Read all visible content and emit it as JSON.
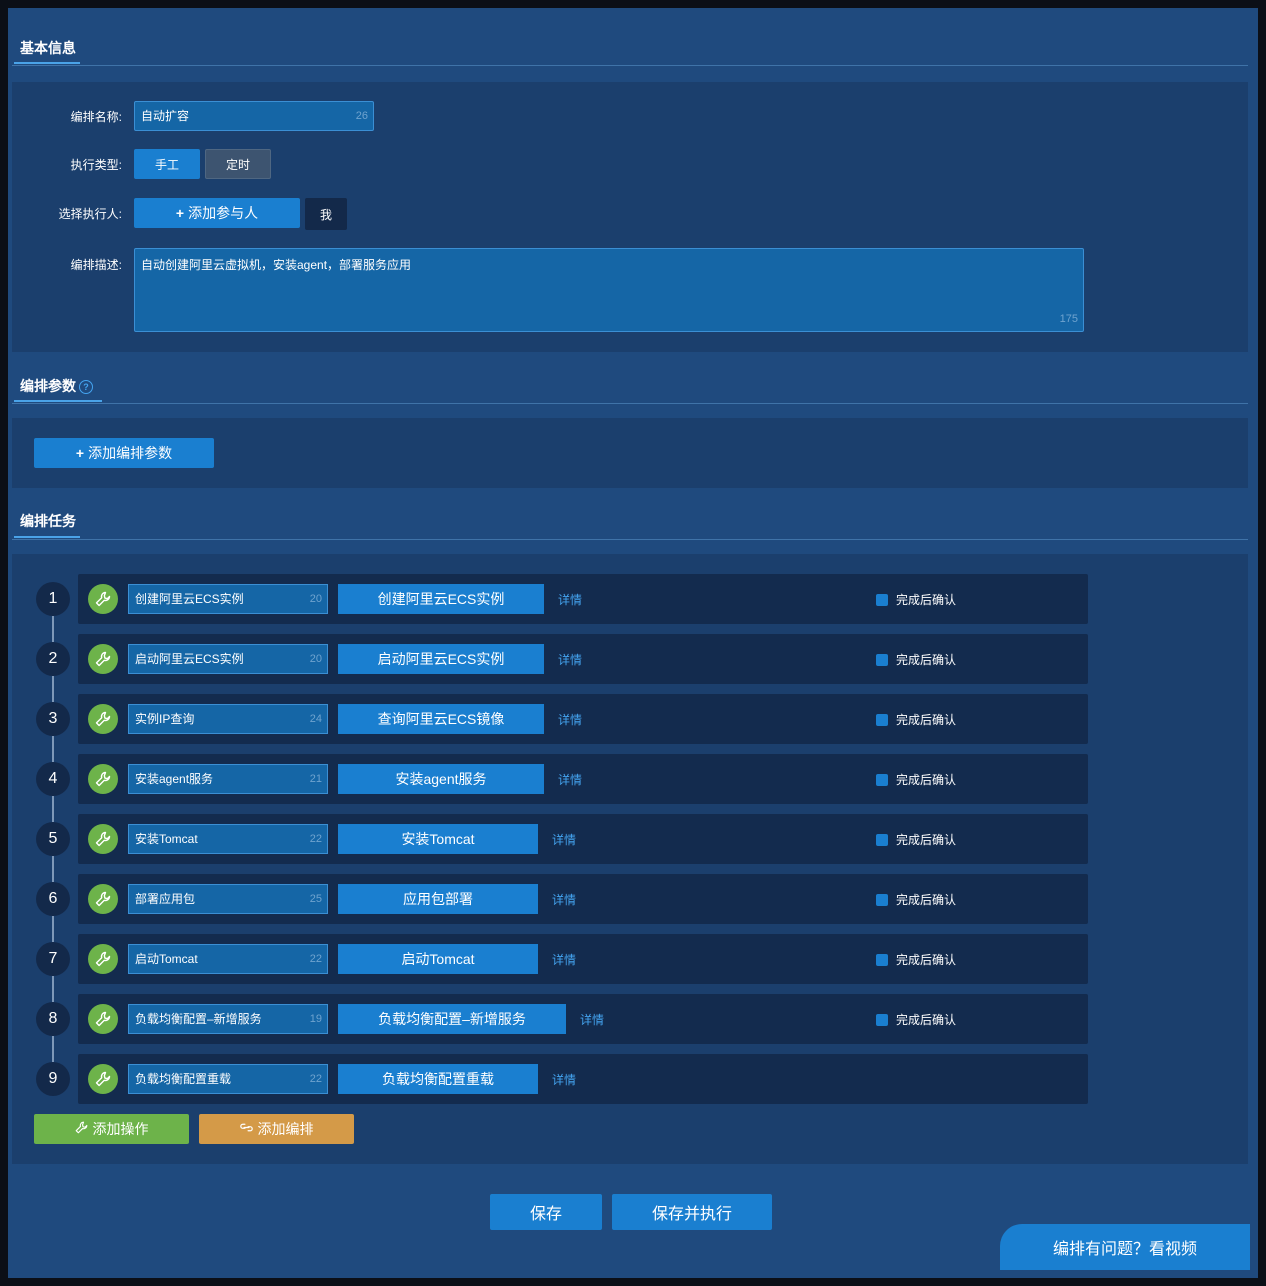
{
  "basic_info": {
    "title": "基本信息",
    "name_label": "编排名称:",
    "name_value": "自动扩容",
    "name_count": "26",
    "type_label": "执行类型:",
    "type_manual": "手工",
    "type_timed": "定时",
    "executor_label": "选择执行人:",
    "add_participant": "添加参与人",
    "me": "我",
    "desc_label": "编排描述:",
    "desc_value": "自动创建阿里云虚拟机，安装agent，部署服务应用",
    "desc_count": "175"
  },
  "params": {
    "title": "编排参数",
    "help": "?",
    "add_param": "添加编排参数"
  },
  "tasks": {
    "title": "编排任务",
    "detail_label": "详情",
    "confirm_label": "完成后确认",
    "items": [
      {
        "num": "1",
        "name": "创建阿里云ECS实例",
        "count": "20",
        "tag": "创建阿里云ECS实例",
        "confirm": true
      },
      {
        "num": "2",
        "name": "启动阿里云ECS实例",
        "count": "20",
        "tag": "启动阿里云ECS实例",
        "confirm": true
      },
      {
        "num": "3",
        "name": "实例IP查询",
        "count": "24",
        "tag": "查询阿里云ECS镜像",
        "confirm": true
      },
      {
        "num": "4",
        "name": "安装agent服务",
        "count": "21",
        "tag": "安装agent服务",
        "confirm": true
      },
      {
        "num": "5",
        "name": "安装Tomcat",
        "count": "22",
        "tag": "安装Tomcat",
        "confirm": true
      },
      {
        "num": "6",
        "name": "部署应用包",
        "count": "25",
        "tag": "应用包部署",
        "confirm": true
      },
      {
        "num": "7",
        "name": "启动Tomcat",
        "count": "22",
        "tag": "启动Tomcat",
        "confirm": true
      },
      {
        "num": "8",
        "name": "负载均衡配置–新增服务",
        "count": "19",
        "tag": "负载均衡配置–新增服务",
        "confirm": true
      },
      {
        "num": "9",
        "name": "负载均衡配置重载",
        "count": "22",
        "tag": "负载均衡配置重载",
        "confirm": false
      }
    ],
    "add_operation": "添加操作",
    "add_orchestration": "添加编排"
  },
  "footer": {
    "save": "保存",
    "save_execute": "保存并执行",
    "video_help": "编排有问题？看视频"
  },
  "colors": {
    "background": "#1f4a7e",
    "panel": "#1b3f6d",
    "primary": "#1a7fd0",
    "success": "#6db34a",
    "warning": "#d49a48"
  }
}
